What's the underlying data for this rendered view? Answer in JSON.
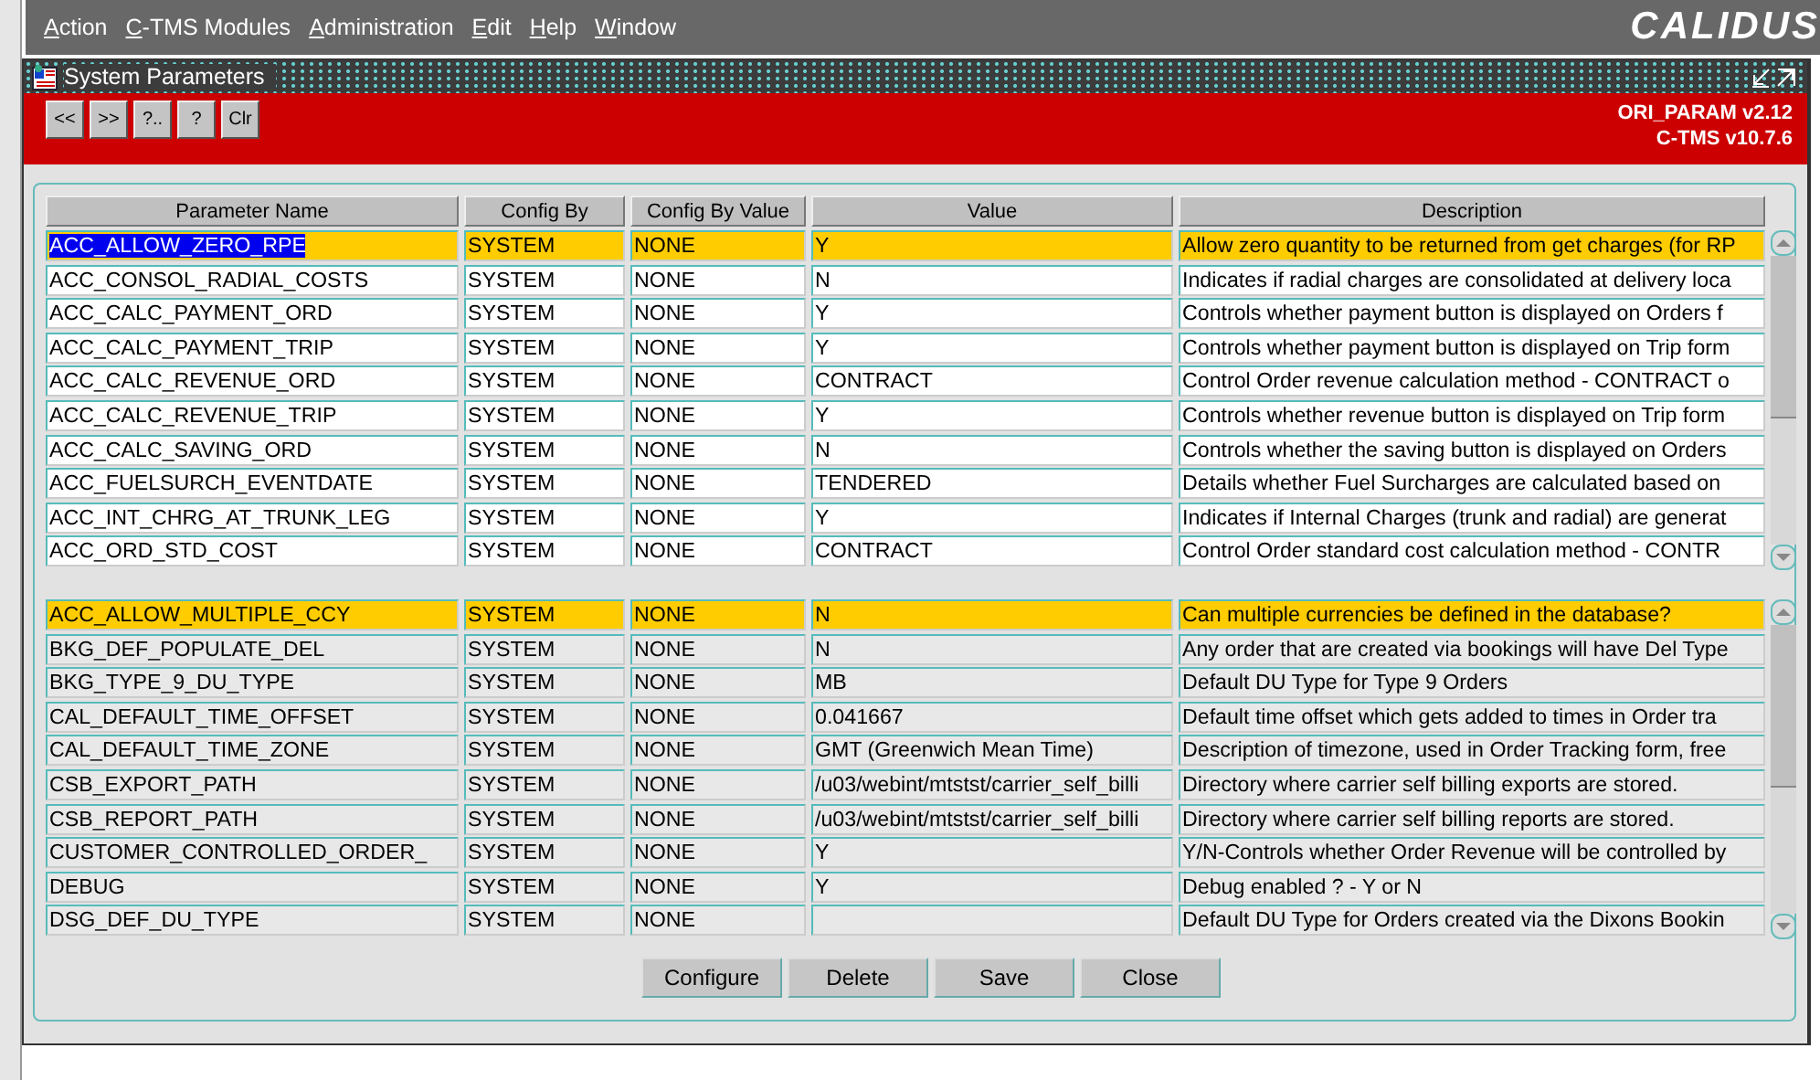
{
  "menu": [
    "Action",
    "C-TMS Modules",
    "Administration",
    "Edit",
    "Help",
    "Window"
  ],
  "logo": "CALIDUS",
  "window": {
    "title": "System Parameters"
  },
  "toolbar": {
    "buttons": [
      "<<",
      ">>",
      "?..",
      "?",
      "Clr"
    ],
    "versions": [
      "ORI_PARAM v2.12",
      "C-TMS v10.7.6"
    ]
  },
  "table": {
    "columns": [
      "Parameter Name",
      "Config By",
      "Config By Value",
      "Value",
      "Description"
    ],
    "blocks": [
      {
        "kind": "editable",
        "rows": [
          {
            "name": "ACC_ALLOW_ZERO_RPE",
            "config_by": "SYSTEM",
            "config_by_value": "NONE",
            "value": "Y",
            "description": "Allow zero quantity to be returned from get charges (for RP",
            "selected": true,
            "focused": true
          },
          {
            "name": "ACC_CONSOL_RADIAL_COSTS",
            "config_by": "SYSTEM",
            "config_by_value": "NONE",
            "value": "N",
            "description": "Indicates if radial charges are consolidated at delivery loca",
            "selected": false,
            "focused": false
          },
          {
            "name": "ACC_CALC_PAYMENT_ORD",
            "config_by": "SYSTEM",
            "config_by_value": "NONE",
            "value": "Y",
            "description": "Controls whether payment button is displayed on Orders f",
            "selected": false,
            "focused": false
          },
          {
            "name": "ACC_CALC_PAYMENT_TRIP",
            "config_by": "SYSTEM",
            "config_by_value": "NONE",
            "value": "Y",
            "description": "Controls whether payment button is displayed on Trip form",
            "selected": false,
            "focused": false
          },
          {
            "name": "ACC_CALC_REVENUE_ORD",
            "config_by": "SYSTEM",
            "config_by_value": "NONE",
            "value": "CONTRACT",
            "description": "Control Order revenue calculation method - CONTRACT o",
            "selected": false,
            "focused": false
          },
          {
            "name": "ACC_CALC_REVENUE_TRIP",
            "config_by": "SYSTEM",
            "config_by_value": "NONE",
            "value": "Y",
            "description": "Controls whether revenue button is displayed on Trip form",
            "selected": false,
            "focused": false
          },
          {
            "name": "ACC_CALC_SAVING_ORD",
            "config_by": "SYSTEM",
            "config_by_value": "NONE",
            "value": "N",
            "description": "Controls whether the saving button is displayed on Orders",
            "selected": false,
            "focused": false
          },
          {
            "name": "ACC_FUELSURCH_EVENTDATE",
            "config_by": "SYSTEM",
            "config_by_value": "NONE",
            "value": "TENDERED",
            "description": "Details whether Fuel Surcharges are calculated based on",
            "selected": false,
            "focused": false
          },
          {
            "name": "ACC_INT_CHRG_AT_TRUNK_LEG",
            "config_by": "SYSTEM",
            "config_by_value": "NONE",
            "value": "Y",
            "description": "Indicates if Internal Charges (trunk and radial) are generat",
            "selected": false,
            "focused": false
          },
          {
            "name": "ACC_ORD_STD_COST",
            "config_by": "SYSTEM",
            "config_by_value": "NONE",
            "value": "CONTRACT",
            "description": "Control Order standard cost calculation method - CONTR",
            "selected": false,
            "focused": false
          }
        ]
      },
      {
        "kind": "readonly",
        "rows": [
          {
            "name": "ACC_ALLOW_MULTIPLE_CCY",
            "config_by": "SYSTEM",
            "config_by_value": "NONE",
            "value": "N",
            "description": "Can multiple currencies be defined in the database?",
            "selected": true,
            "focused": false
          },
          {
            "name": "BKG_DEF_POPULATE_DEL",
            "config_by": "SYSTEM",
            "config_by_value": "NONE",
            "value": "N",
            "description": "Any order that are created via bookings will have Del Type",
            "selected": false,
            "focused": false
          },
          {
            "name": "BKG_TYPE_9_DU_TYPE",
            "config_by": "SYSTEM",
            "config_by_value": "NONE",
            "value": "MB",
            "description": "Default DU Type for Type 9 Orders",
            "selected": false,
            "focused": false
          },
          {
            "name": "CAL_DEFAULT_TIME_OFFSET",
            "config_by": "SYSTEM",
            "config_by_value": "NONE",
            "value": "0.041667",
            "description": "Default time offset which gets added to times in Order tra",
            "selected": false,
            "focused": false
          },
          {
            "name": "CAL_DEFAULT_TIME_ZONE",
            "config_by": "SYSTEM",
            "config_by_value": "NONE",
            "value": "GMT (Greenwich Mean Time)",
            "description": "Description of timezone, used in Order Tracking form, free",
            "selected": false,
            "focused": false
          },
          {
            "name": "CSB_EXPORT_PATH",
            "config_by": "SYSTEM",
            "config_by_value": "NONE",
            "value": "/u03/webint/mtstst/carrier_self_billi",
            "description": "Directory where carrier self billing exports are stored.",
            "selected": false,
            "focused": false
          },
          {
            "name": "CSB_REPORT_PATH",
            "config_by": "SYSTEM",
            "config_by_value": "NONE",
            "value": "/u03/webint/mtstst/carrier_self_billi",
            "description": "Directory where carrier self billing reports are stored.",
            "selected": false,
            "focused": false
          },
          {
            "name": "CUSTOMER_CONTROLLED_ORDER_",
            "config_by": "SYSTEM",
            "config_by_value": "NONE",
            "value": "Y",
            "description": "Y/N-Controls whether Order Revenue will be controlled by",
            "selected": false,
            "focused": false
          },
          {
            "name": "DEBUG",
            "config_by": "SYSTEM",
            "config_by_value": "NONE",
            "value": "Y",
            "description": "Debug enabled ? - Y or N",
            "selected": false,
            "focused": false
          },
          {
            "name": "DSG_DEF_DU_TYPE",
            "config_by": "SYSTEM",
            "config_by_value": "NONE",
            "value": "",
            "description": "Default DU Type for Orders created via the Dixons Bookin",
            "selected": false,
            "focused": false
          }
        ]
      }
    ]
  },
  "actions": [
    "Configure",
    "Delete",
    "Save",
    "Close"
  ]
}
